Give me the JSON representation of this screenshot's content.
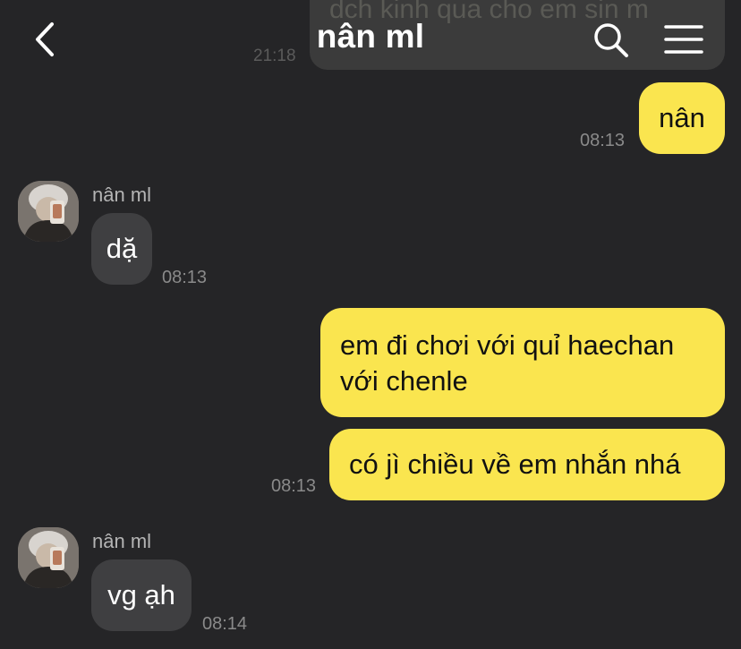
{
  "header": {
    "title": "nân ml",
    "back_icon": "chevron-left-icon",
    "search_icon": "search-icon",
    "menu_icon": "hamburger-menu-icon"
  },
  "colors": {
    "background": "#252527",
    "sent_bubble": "#fae54f",
    "received_bubble": "#3f3f41"
  },
  "partial_message": {
    "text": "dch kinh qua cho em sin m",
    "time": "21:18"
  },
  "messages": [
    {
      "direction": "sent",
      "text": "nân",
      "time": "08:13"
    },
    {
      "direction": "received",
      "sender": "nân ml",
      "text": "dặ",
      "time": "08:13"
    },
    {
      "direction": "sent",
      "text": "em đi chơi với quỉ haechan với chenle"
    },
    {
      "direction": "sent",
      "text": "có jì chiều về em nhắn nhá",
      "time": "08:13"
    },
    {
      "direction": "received",
      "sender": "nân ml",
      "text": "vg ạh",
      "time": "08:14"
    }
  ]
}
